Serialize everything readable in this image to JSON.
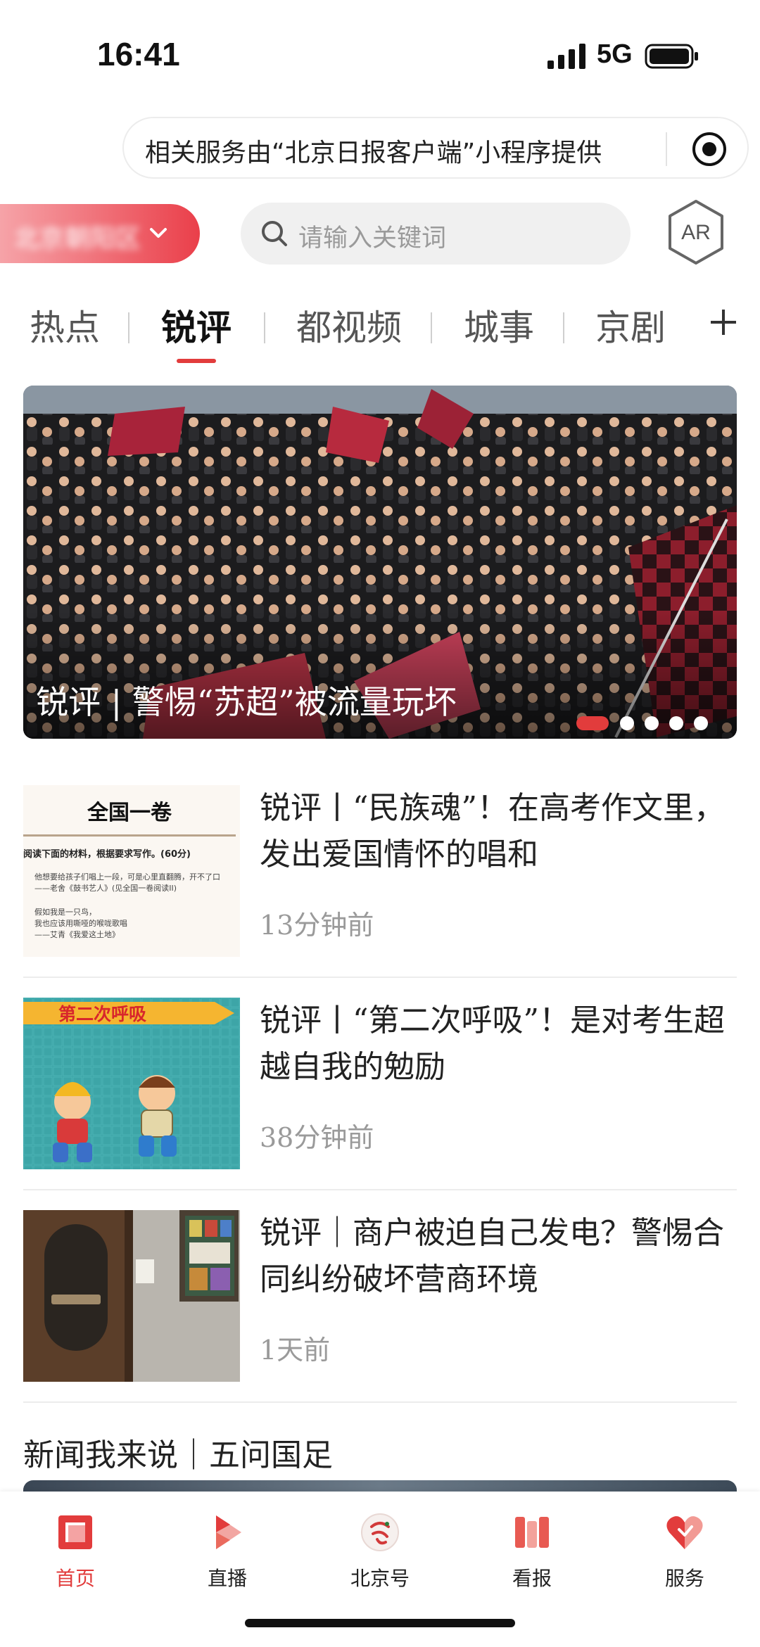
{
  "status_bar": {
    "time": "16:41",
    "network": "5G"
  },
  "notice": {
    "text": "相关服务由“北京日报客户端”小程序提供"
  },
  "header": {
    "location_label": "北京朝阳区",
    "search_placeholder": "请输入关键词",
    "ar_label": "AR"
  },
  "tabs": [
    {
      "label": "热点",
      "active": false
    },
    {
      "label": "锐评",
      "active": true
    },
    {
      "label": "都视频",
      "active": false
    },
    {
      "label": "城事",
      "active": false
    },
    {
      "label": "京剧",
      "active": false
    }
  ],
  "carousel": {
    "caption": "锐评 | 警惕“苏超”被流量玩坏",
    "slide_count": 5,
    "active_index": 0
  },
  "news": [
    {
      "title": "锐评丨“民族魂”！在高考作文里，发出爱国情怀的唱和",
      "time": "13分钟前",
      "thumb": {
        "heading": "全国一卷",
        "prompt": "阅读下面的材料，根据要求写作。(60分)",
        "line1": "他想要给孩子们唱上一段，可是心里直翻腾，开不了口",
        "line2": "——老舍《鼓书艺人》(见全国一卷阅读II)",
        "line3": "假如我是一只鸟，",
        "line4": "我也应该用嘶哑的喉咙歌唱",
        "line5": "——艾青《我爱这土地》"
      }
    },
    {
      "title": "锐评丨“第二次呼吸”！是对考生超越自我的勉励",
      "time": "38分钟前",
      "thumb": {
        "banner": "第二次呼吸"
      }
    },
    {
      "title": "锐评｜商户被迫自己发电？警惕合同纠纷破坏营商环境",
      "time": "1天前"
    }
  ],
  "section": {
    "title": "新闻我来说｜五问国足"
  },
  "bottom_nav": [
    {
      "label": "首页",
      "icon": "home-icon",
      "active": true
    },
    {
      "label": "直播",
      "icon": "live-icon",
      "active": false
    },
    {
      "label": "北京号",
      "icon": "beijing-hao-icon",
      "active": false
    },
    {
      "label": "看报",
      "icon": "newspaper-icon",
      "active": false
    },
    {
      "label": "服务",
      "icon": "service-icon",
      "active": false
    }
  ],
  "colors": {
    "accent": "#e23c3c",
    "muted": "#9a9a9a",
    "text": "#222222"
  }
}
